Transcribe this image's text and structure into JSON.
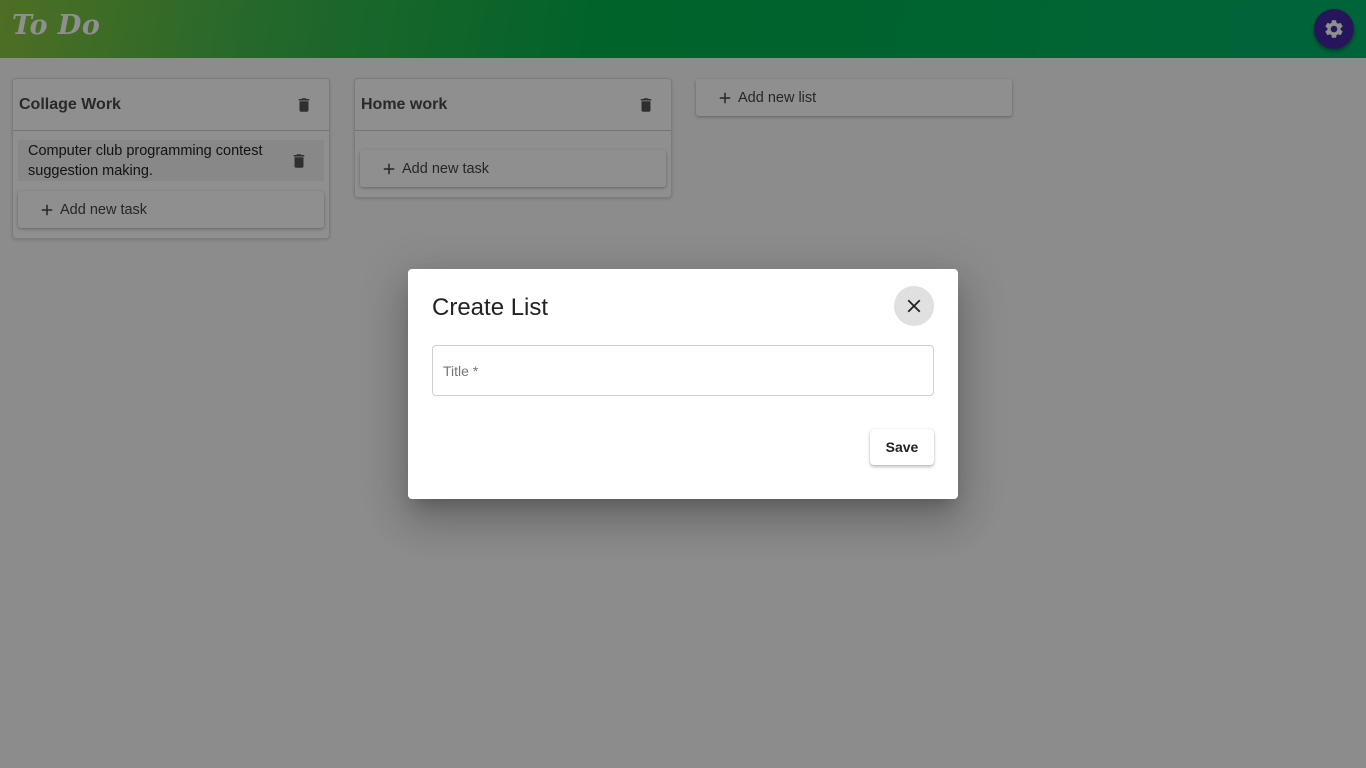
{
  "app": {
    "title": "To Do"
  },
  "header": {
    "settings_icon": "gear-icon",
    "settings_color": "#4527a0"
  },
  "lists": [
    {
      "title": "Collage Work",
      "tasks": [
        {
          "text": "Computer club programming contest suggestion making."
        }
      ],
      "add_task_label": "Add new task"
    },
    {
      "title": "Home work",
      "tasks": [],
      "add_task_label": "Add new task"
    }
  ],
  "add_list_label": "Add new list",
  "dialog": {
    "title": "Create List",
    "title_field": {
      "placeholder": "Title *",
      "value": ""
    },
    "save_label": "Save",
    "close_icon": "close-icon"
  },
  "colors": {
    "header_gradient_start": "#8bc53f",
    "header_gradient_end": "#00b36a",
    "overlay": "rgba(0,0,0,0.44)"
  }
}
